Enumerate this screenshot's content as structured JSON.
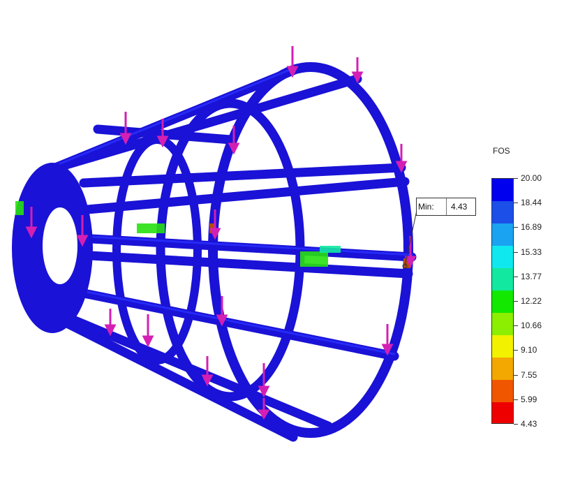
{
  "legend": {
    "title": "FOS",
    "labels": [
      "20.00",
      "18.44",
      "16.89",
      "15.33",
      "13.77",
      "12.22",
      "10.66",
      "9.10",
      "7.55",
      "5.99",
      "4.43"
    ],
    "colors": [
      "#0000ee",
      "#1b4fe8",
      "#1aa3f0",
      "#10e8f0",
      "#12e8a0",
      "#12e800",
      "#8cee00",
      "#f2f200",
      "#f2a800",
      "#f05600",
      "#ee0000"
    ]
  },
  "min_label": {
    "prefix": "Min:",
    "value": "4.43"
  },
  "colors": {
    "frame": "#1a12d6",
    "frame_dark": "#0c0aa0",
    "load_arrow": "#d41fb4",
    "hot_spot": "#b84a10",
    "stress_green": "#28e010"
  }
}
